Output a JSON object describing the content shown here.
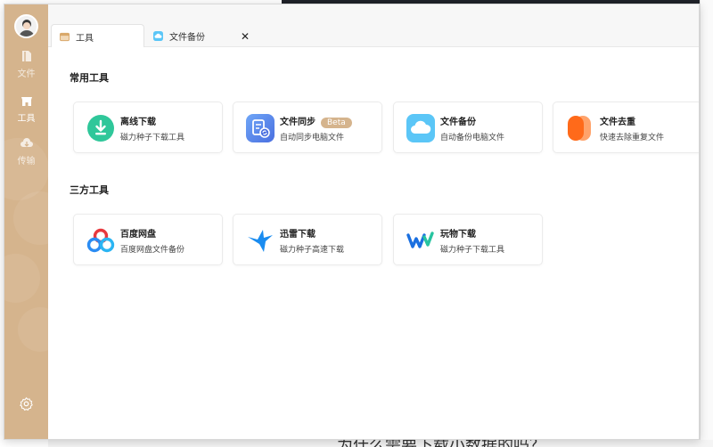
{
  "sidebar": {
    "items": [
      {
        "label": "文件"
      },
      {
        "label": "工具"
      },
      {
        "label": "传输"
      }
    ]
  },
  "tabs": [
    {
      "label": "工具"
    },
    {
      "label": "文件备份",
      "close": "✕"
    }
  ],
  "window_controls": {
    "minimize": "—",
    "maximize": "☐",
    "close": "✕"
  },
  "sections": [
    {
      "title": "常用工具",
      "cards": [
        {
          "title": "离线下载",
          "desc": "磁力种子下载工具",
          "icon": "download-icon"
        },
        {
          "title": "文件同步",
          "badge": "Beta",
          "desc": "自动同步电脑文件",
          "icon": "sync-icon"
        },
        {
          "title": "文件备份",
          "desc": "自动备份电脑文件",
          "icon": "cloud-icon"
        },
        {
          "title": "文件去重",
          "desc": "快速去除重复文件",
          "icon": "dedup-icon"
        }
      ]
    },
    {
      "title": "三方工具",
      "cards": [
        {
          "title": "百度网盘",
          "desc": "百度网盘文件备份",
          "icon": "baidu-icon"
        },
        {
          "title": "迅雷下载",
          "desc": "磁力种子高速下载",
          "icon": "thunder-icon"
        },
        {
          "title": "玩物下载",
          "desc": "磁力种子下载工具",
          "icon": "wanwu-icon"
        }
      ]
    }
  ],
  "background": {
    "bottom_text": "为什么需要下载小数据的吗？"
  },
  "colors": {
    "accent": "#d5b48d",
    "sidebar": "#d5b48d"
  }
}
